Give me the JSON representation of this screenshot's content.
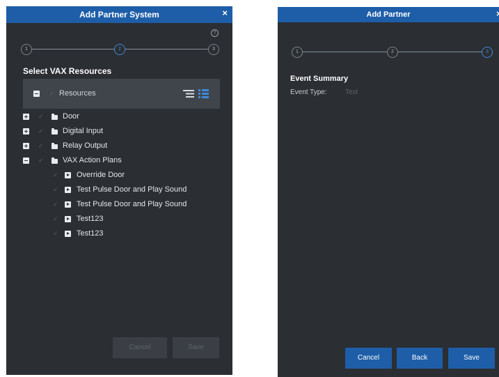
{
  "left": {
    "title": "Add Partner System",
    "close": "×",
    "steps": [
      "1",
      "2",
      "3"
    ],
    "help": "?",
    "section_title": "Select VAX Resources",
    "resources_label": "Resources",
    "tree": [
      {
        "label": "Door"
      },
      {
        "label": "Digital Input"
      },
      {
        "label": "Relay Output"
      },
      {
        "label": "VAX Action Plans"
      }
    ],
    "plans": [
      {
        "label": "Override Door"
      },
      {
        "label": "Test Pulse Door and Play Sound"
      },
      {
        "label": "Test Pulse Door and Play Sound"
      },
      {
        "label": "Test123"
      },
      {
        "label": "Test123"
      }
    ],
    "buttons": {
      "cancel": "Cancel",
      "save": "Save"
    }
  },
  "right": {
    "title": "Add Partner",
    "close": "×",
    "steps": [
      "1",
      "2",
      "3"
    ],
    "section_title": "Event Summary",
    "event_type_label": "Event Type:",
    "event_type_value": "Text",
    "buttons": {
      "cancel": "Cancel",
      "back": "Back",
      "save": "Save"
    }
  }
}
